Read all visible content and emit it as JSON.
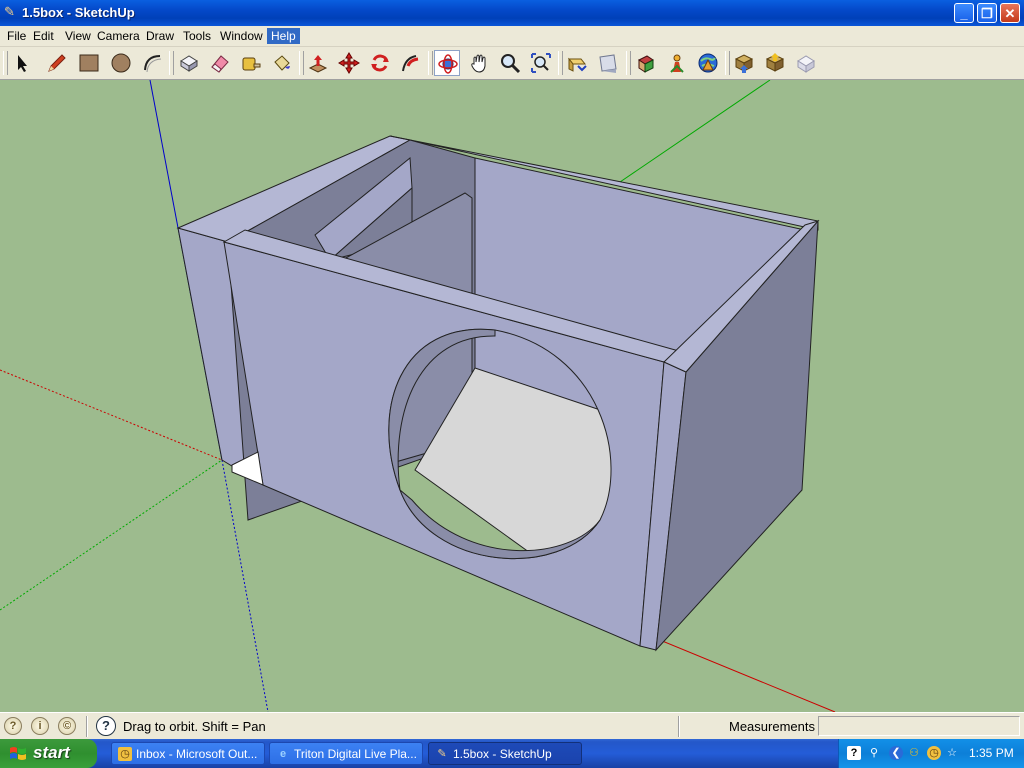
{
  "window": {
    "title": "1.5box - SketchUp",
    "minimize_glyph": "_",
    "maximize_glyph": "❐",
    "close_glyph": "✕"
  },
  "menu": [
    {
      "label": "File"
    },
    {
      "label": "Edit"
    },
    {
      "label": "View"
    },
    {
      "label": "Camera"
    },
    {
      "label": "Draw"
    },
    {
      "label": "Tools"
    },
    {
      "label": "Window"
    },
    {
      "label": "Help",
      "active": true
    }
  ],
  "toolbar": {
    "tools": [
      "select-icon",
      "pencil-icon",
      "rectangle-icon",
      "circle-icon",
      "arc-icon",
      "make-component-icon",
      "eraser-icon",
      "tape-measure-icon",
      "paint-bucket-icon",
      "push-pull-icon",
      "move-icon",
      "rotate-icon",
      "follow-me-icon",
      "orbit-icon",
      "pan-icon",
      "zoom-icon",
      "zoom-extents-icon",
      "previous-view-icon",
      "next-view-icon",
      "get-models-icon",
      "share-model-icon",
      "google-earth-icon",
      "get-current-view-icon",
      "toggle-terrain-icon",
      "place-model-icon",
      "warehouse-icon"
    ],
    "pressed": "orbit-icon"
  },
  "viewport": {
    "background_color": "#9dbb8e",
    "face_color": "#a4a7c8",
    "shadow_face_color": "#7c7f98",
    "axis_red": "#cc0000",
    "axis_green": "#00aa00",
    "axis_blue": "#0000cc"
  },
  "status": {
    "text": "Drag to orbit.  Shift = Pan",
    "measurements_label": "Measurements",
    "measurements_value": ""
  },
  "taskbar": {
    "start_label": "start",
    "tasks": [
      {
        "label": "Inbox - Microsoft Out...",
        "icon": "outlook-icon",
        "active": false
      },
      {
        "label": "Triton Digital Live Pla...",
        "icon": "ie-icon",
        "active": false
      },
      {
        "label": "1.5box - SketchUp",
        "icon": "sketchup-icon",
        "active": true
      }
    ],
    "clock": "1:35 PM"
  }
}
